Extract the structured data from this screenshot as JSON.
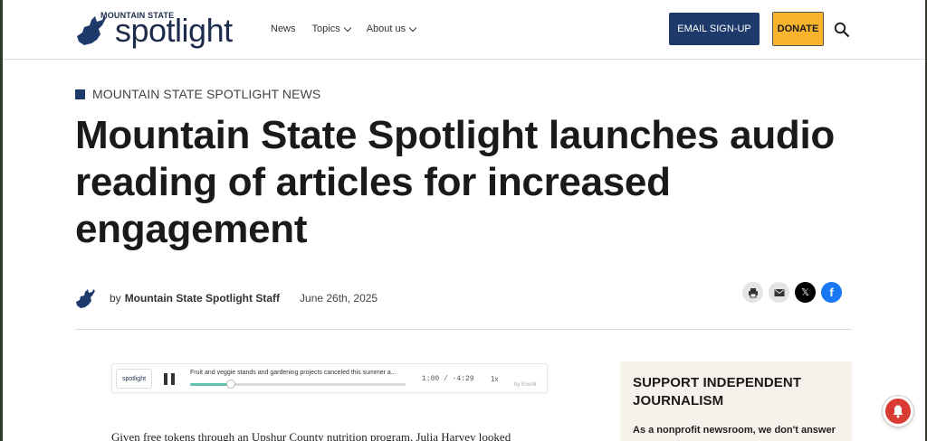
{
  "header": {
    "logo_small": "MOUNTAIN STATE",
    "logo_big": "spotlight",
    "nav": [
      {
        "label": "News",
        "has_dropdown": false
      },
      {
        "label": "Topics",
        "has_dropdown": true
      },
      {
        "label": "About us",
        "has_dropdown": true
      }
    ],
    "email_button": "EMAIL SIGN-UP",
    "donate_button": "DONATE",
    "colors": {
      "navy": "#1d3a6b",
      "donate": "#f9b42d"
    }
  },
  "article": {
    "kicker": "MOUNTAIN STATE SPOTLIGHT NEWS",
    "headline": "Mountain State Spotlight launches audio reading of articles for increased engagement",
    "byline_prefix": "by",
    "author": "Mountain State Spotlight Staff",
    "date": "June 26th, 2025",
    "share": [
      "print-icon",
      "email-icon",
      "x-icon",
      "facebook-icon"
    ],
    "body_start": "Given free tokens through an Upshur County nutrition program, Julia Harvey looked"
  },
  "player": {
    "logo": "spotlight",
    "title": "Fruit and veggie stands and gardening projects canceled this summer a...",
    "time": "1:00 / -4:29",
    "speed": "1x",
    "brand": "by Everlit",
    "progress": 0.19
  },
  "sidebar": {
    "title": "SUPPORT INDEPENDENT JOURNALISM",
    "text": "As a nonprofit newsroom, we don't answer"
  }
}
